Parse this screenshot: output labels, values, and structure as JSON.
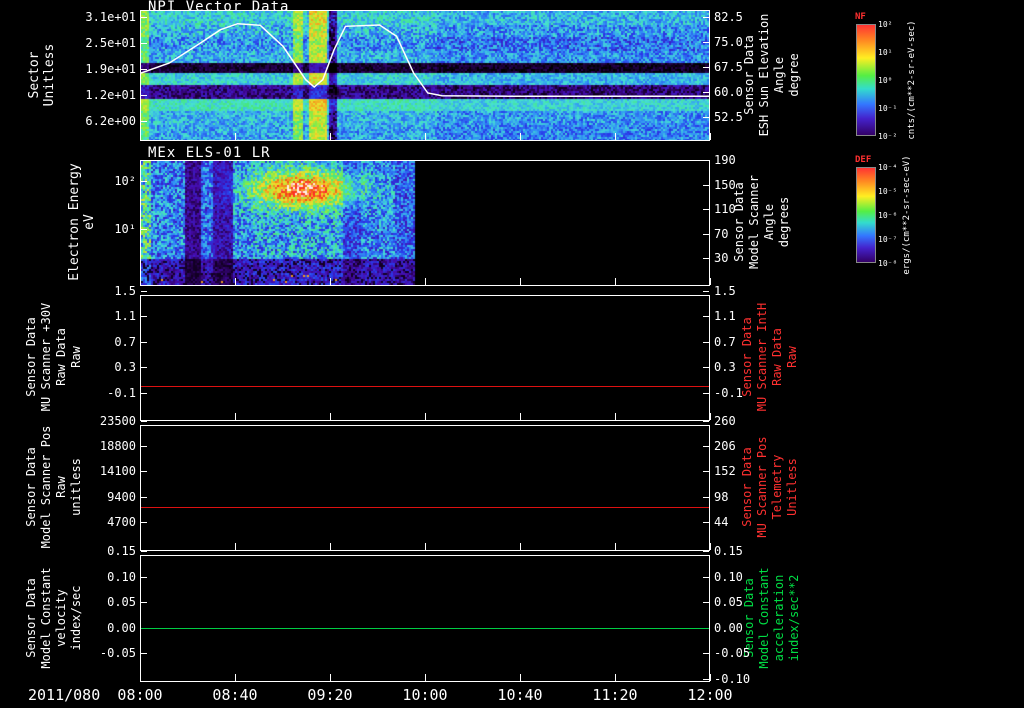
{
  "x_axis": {
    "date_label": "2011/080",
    "ticks": [
      "08:00",
      "08:40",
      "09:20",
      "10:00",
      "10:40",
      "11:20",
      "12:00"
    ]
  },
  "panels": [
    {
      "id": "npi",
      "title": "NPI Vector Data",
      "left_title": "Sector\nUnitless",
      "left_ticks": [
        "3.1e+01",
        "2.5e+01",
        "1.9e+01",
        "1.2e+01",
        "6.2e+00"
      ],
      "right_ticks": [
        "82.5",
        "75.0",
        "67.5",
        "60.0",
        "52.5"
      ],
      "right_title": "Sensor Data\nESH Sun Elevation\nAngle\ndegree",
      "right_title_color": "#ffffff"
    },
    {
      "id": "els",
      "title": "MEx ELS-01 LR",
      "left_title": "Electron Energy\neV",
      "left_ticks": [
        "10²",
        "10¹"
      ],
      "right_ticks": [
        "190",
        "150",
        "110",
        "70",
        "30"
      ],
      "right_title": "Sensor Data\nModel Scanner\nAngle\ndegrees",
      "right_title_color": "#ffffff"
    },
    {
      "id": "mu-scanner-30v",
      "title": "",
      "left_title": "Sensor Data\nMU Scanner +30V\nRaw Data\nRaw",
      "left_ticks": [
        "1.5",
        "1.1",
        "0.7",
        "0.3",
        "-0.1"
      ],
      "right_ticks": [
        "1.5",
        "1.1",
        "0.7",
        "0.3",
        "-0.1"
      ],
      "right_title": "Sensor Data\nMU Scanner IntH\nRaw Data\nRaw",
      "right_title_color": "#ff3030"
    },
    {
      "id": "model-scanner-pos",
      "title": "",
      "left_title": "Sensor Data\nModel Scanner Pos\nRaw\nunitless",
      "left_ticks": [
        "23500",
        "18800",
        "14100",
        "9400",
        "4700"
      ],
      "right_ticks": [
        "260",
        "206",
        "152",
        "98",
        "44"
      ],
      "right_title": "Sensor Data\nMU Scanner Pos\nTelemetry\nUnitless",
      "right_title_color": "#ff3030"
    },
    {
      "id": "model-constant",
      "title": "",
      "left_title": "Sensor Data\nModel Constant\nvelocity\nindex/sec",
      "left_ticks": [
        "0.15",
        "0.10",
        "0.05",
        "0.00",
        "-0.05"
      ],
      "right_ticks": [
        "0.15",
        "0.10",
        "0.05",
        "0.00",
        "-0.05",
        "-0.10"
      ],
      "right_title": "Sensor Data\nModel Constant\nacceleration\nindex/sec**2",
      "right_title_color": "#00dd44"
    }
  ],
  "colorbars": [
    {
      "name": "NF",
      "units": "cnts/(cm**2-sr-eV-sec)",
      "ticks": [
        "10²",
        "10¹",
        "10⁰",
        "10⁻¹",
        "10⁻²"
      ]
    },
    {
      "name": "DEF",
      "units": "ergs/(cm**2-sr-sec-eV)",
      "ticks": [
        "10⁻⁴",
        "10⁻⁵",
        "10⁻⁶",
        "10⁻⁷",
        "10⁻⁸"
      ]
    }
  ],
  "chart_data": [
    {
      "type": "heatmap",
      "title": "NPI Vector Data",
      "ylabel": "Sector Unitless",
      "y_ticks": [
        "3.1e+01",
        "2.5e+01",
        "1.9e+01",
        "1.2e+01",
        "6.2e+00"
      ],
      "x_ticks": [
        "08:00",
        "08:40",
        "09:20",
        "10:00",
        "10:40",
        "11:20",
        "12:00"
      ],
      "colorbar": {
        "name": "NF",
        "units": "cnts/(cm**2-sr-eV-sec)"
      },
      "description": "Cyan/blue sector-time spectrogram; dark band near sector 19, dim purple band near sector 12, bright vertical enhancement near 09:05-09:25",
      "bands": [
        {
          "y0": 0.0,
          "y1": 0.1,
          "v": 0.4,
          "n": 0.1
        },
        {
          "y0": 0.1,
          "y1": 0.19,
          "v": 0.36,
          "n": 0.12
        },
        {
          "y0": 0.19,
          "y1": 0.3,
          "v": 0.32,
          "n": 0.12
        },
        {
          "y0": 0.3,
          "y1": 0.4,
          "v": 0.35,
          "n": 0.1
        },
        {
          "y0": 0.4,
          "y1": 0.475,
          "v": 0.04,
          "n": 0.04
        },
        {
          "y0": 0.475,
          "y1": 0.565,
          "v": 0.4,
          "n": 0.08
        },
        {
          "y0": 0.565,
          "y1": 0.68,
          "v": 0.1,
          "n": 0.07
        },
        {
          "y0": 0.68,
          "y1": 0.775,
          "v": 0.44,
          "n": 0.07
        },
        {
          "y0": 0.775,
          "y1": 0.875,
          "v": 0.36,
          "n": 0.1
        },
        {
          "y0": 0.875,
          "y1": 1.0,
          "v": 0.34,
          "n": 0.1
        }
      ],
      "streaks": [
        {
          "x0": 0.0,
          "x1": 0.012,
          "d": 0.18
        },
        {
          "x0": 0.265,
          "x1": 0.285,
          "d": 0.22
        },
        {
          "x0": 0.295,
          "x1": 0.325,
          "d": 0.3
        },
        {
          "x0": 0.33,
          "x1": 0.345,
          "d": -0.25
        },
        {
          "x0": 0.52,
          "x1": 1.0,
          "d": -0.04
        }
      ],
      "overlay_series": {
        "name": "ESH Sun Elevation Angle",
        "axis": "right",
        "units": "degree",
        "color": "#ffffff",
        "right_ticks": [
          82.5,
          75.0,
          67.5,
          60.0,
          52.5
        ],
        "points": [
          [
            0.0,
            66
          ],
          [
            0.05,
            69
          ],
          [
            0.1,
            74.5
          ],
          [
            0.14,
            79
          ],
          [
            0.17,
            80.8
          ],
          [
            0.21,
            80.3
          ],
          [
            0.25,
            74
          ],
          [
            0.29,
            64
          ],
          [
            0.305,
            61.8
          ],
          [
            0.32,
            64
          ],
          [
            0.34,
            73
          ],
          [
            0.36,
            80
          ],
          [
            0.42,
            80.4
          ],
          [
            0.45,
            77
          ],
          [
            0.48,
            66
          ],
          [
            0.505,
            60
          ],
          [
            0.53,
            59.2
          ],
          [
            0.65,
            59
          ],
          [
            0.8,
            59
          ],
          [
            1.0,
            59
          ]
        ]
      }
    },
    {
      "type": "heatmap",
      "title": "MEx ELS-01 LR",
      "ylabel": "Electron Energy eV",
      "y_scale": "log",
      "y_ticks": [
        "10²",
        "10¹"
      ],
      "right_axis": {
        "label": "Sensor Data Model Scanner Angle degrees",
        "ticks": [
          190,
          150,
          110,
          70,
          30
        ]
      },
      "colorbar": {
        "name": "DEF",
        "units": "ergs/(cm**2-sr-sec-eV)"
      },
      "data_extent_frac_x": [
        0.0,
        0.482
      ],
      "description": "Green/blue noisy electron spectrogram 08:00-~10:00; intense red-orange enhancement ~08:48-09:28 at 30-100 eV; no data after ~10:00",
      "stripes": [
        [
          0.0,
          0.03,
          1.5
        ],
        [
          0.03,
          0.14,
          1.0
        ],
        [
          0.155,
          0.215,
          0.35
        ],
        [
          0.215,
          0.26,
          0.9
        ],
        [
          0.26,
          0.33,
          0.45
        ],
        [
          0.33,
          0.4,
          1.05
        ],
        [
          0.4,
          0.73,
          1.15
        ],
        [
          0.73,
          0.8,
          0.75
        ],
        [
          0.8,
          0.92,
          1.0
        ],
        [
          0.92,
          1.0,
          0.85
        ]
      ],
      "blob": {
        "cx": 0.59,
        "cy": 0.22,
        "rx": 0.18,
        "ry": 0.14,
        "amp": 0.58
      }
    },
    {
      "type": "line",
      "title": "Sensor Data MU Scanner +30V Raw Data Raw",
      "left_ticks": [
        1.5,
        1.1,
        0.7,
        0.3,
        -0.1
      ],
      "right_label": "Sensor Data MU Scanner IntH Raw Data Raw",
      "right_ticks": [
        1.5,
        1.1,
        0.7,
        0.3,
        -0.1
      ],
      "series": [
        {
          "name": "MU Scanner IntH Raw",
          "color": "#dd1111",
          "constant_value": 0.0
        }
      ]
    },
    {
      "type": "line",
      "title": "Sensor Data Model Scanner Pos Raw unitless",
      "left_ticks": [
        23500,
        18800,
        14100,
        9400,
        4700
      ],
      "right_label": "Sensor Data MU Scanner Pos Telemetry Unitless",
      "right_ticks": [
        260,
        206,
        152,
        98,
        44
      ],
      "series": [
        {
          "name": "MU Scanner Pos Telemetry",
          "color": "#dd1111",
          "constant_value": 7500,
          "constant_value_right_axis": 76
        }
      ]
    },
    {
      "type": "line",
      "title": "Sensor Data Model Constant velocity index/sec",
      "left_ticks": [
        0.15,
        0.1,
        0.05,
        0.0,
        -0.05
      ],
      "right_label": "Sensor Data Model Constant acceleration index/sec**2",
      "right_ticks": [
        0.15,
        0.1,
        0.05,
        0.0,
        -0.05,
        -0.1
      ],
      "series": [
        {
          "name": "Model Constant acceleration",
          "color": "#00cc44",
          "constant_value": 0.0
        }
      ]
    }
  ]
}
